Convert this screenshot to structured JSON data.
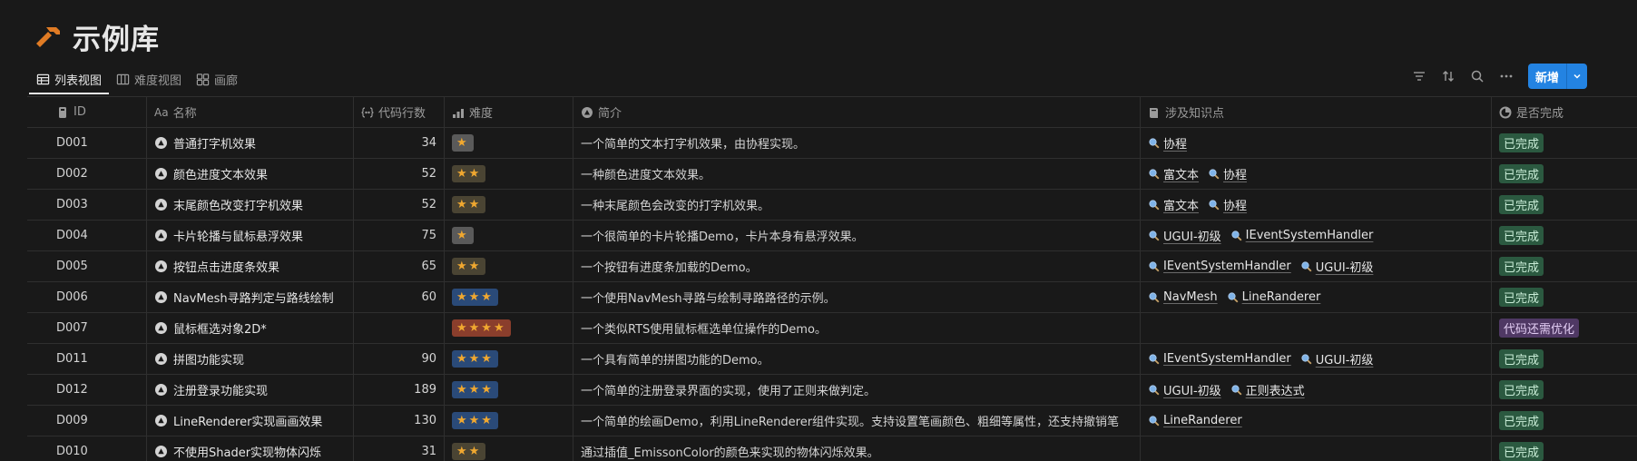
{
  "page": {
    "title": "示例库",
    "icon": "hammer-icon",
    "accent": "#e07b24"
  },
  "tabs": [
    {
      "label": "列表视图",
      "icon": "table-icon",
      "active": true
    },
    {
      "label": "难度视图",
      "icon": "board-icon",
      "active": false
    },
    {
      "label": "画廊",
      "icon": "gallery-icon",
      "active": false
    }
  ],
  "toolbar": {
    "icons": [
      "filter-icon",
      "sort-icon",
      "search-icon",
      "more-icon"
    ],
    "new_label": "新增",
    "new_color": "#2383e2"
  },
  "columns": {
    "id": "ID",
    "name": "名称",
    "lines": "代码行数",
    "difficulty": "难度",
    "desc": "简介",
    "knowledge": "涉及知识点",
    "done": "是否完成"
  },
  "rows": [
    {
      "id": "D001",
      "name": "普通打字机效果",
      "lines": "34",
      "stars": "★",
      "level": 1,
      "desc": "一个简单的文本打字机效果，由协程实现。",
      "tags": [
        "协程"
      ],
      "status": "已完成",
      "status_type": "ok"
    },
    {
      "id": "D002",
      "name": "颜色进度文本效果",
      "lines": "52",
      "stars": "★★",
      "level": 2,
      "desc": "一种颜色进度文本效果。",
      "tags": [
        "富文本",
        "协程"
      ],
      "status": "已完成",
      "status_type": "ok"
    },
    {
      "id": "D003",
      "name": "末尾颜色改变打字机效果",
      "lines": "52",
      "stars": "★★",
      "level": 2,
      "desc": "一种末尾颜色会改变的打字机效果。",
      "tags": [
        "富文本",
        "协程"
      ],
      "status": "已完成",
      "status_type": "ok"
    },
    {
      "id": "D004",
      "name": "卡片轮播与鼠标悬浮效果",
      "lines": "75",
      "stars": "★",
      "level": 1,
      "desc": "一个很简单的卡片轮播Demo，卡片本身有悬浮效果。",
      "tags": [
        "UGUI-初级",
        "IEventSystemHandler"
      ],
      "status": "已完成",
      "status_type": "ok"
    },
    {
      "id": "D005",
      "name": "按钮点击进度条效果",
      "lines": "65",
      "stars": "★★",
      "level": 2,
      "desc": "一个按钮有进度条加载的Demo。",
      "tags": [
        "IEventSystemHandler",
        "UGUI-初级"
      ],
      "status": "已完成",
      "status_type": "ok"
    },
    {
      "id": "D006",
      "name": "NavMesh寻路判定与路线绘制",
      "lines": "60",
      "stars": "★★★",
      "level": 3,
      "desc": "一个使用NavMesh寻路与绘制寻路路径的示例。",
      "tags": [
        "NavMesh",
        "LineRanderer"
      ],
      "status": "已完成",
      "status_type": "ok"
    },
    {
      "id": "D007",
      "name": "鼠标框选对象2D*",
      "lines": "",
      "stars": "★★★★",
      "level": 4,
      "desc": "一个类似RTS使用鼠标框选单位操作的Demo。",
      "tags": [],
      "status": "代码还需优化",
      "status_type": "opt"
    },
    {
      "id": "D011",
      "name": "拼图功能实现",
      "lines": "90",
      "stars": "★★★",
      "level": 3,
      "desc": "一个具有简单的拼图功能的Demo。",
      "tags": [
        "IEventSystemHandler",
        "UGUI-初级"
      ],
      "status": "已完成",
      "status_type": "ok"
    },
    {
      "id": "D012",
      "name": "注册登录功能实现",
      "lines": "189",
      "stars": "★★★",
      "level": 3,
      "desc": "一个简单的注册登录界面的实现，使用了正则来做判定。",
      "tags": [
        "UGUI-初级",
        "正则表达式"
      ],
      "status": "已完成",
      "status_type": "ok"
    },
    {
      "id": "D009",
      "name": "LineRenderer实现画画效果",
      "lines": "130",
      "stars": "★★★",
      "level": 3,
      "desc": "一个简单的绘画Demo，利用LineRenderer组件实现。支持设置笔画颜色、粗细等属性，还支持撤销笔",
      "tags": [
        "LineRanderer"
      ],
      "status": "已完成",
      "status_type": "ok"
    },
    {
      "id": "D010",
      "name": "不使用Shader实现物体闪烁",
      "lines": "31",
      "stars": "★★",
      "level": 2,
      "desc": "通过插值_EmissonColor的颜色来实现的物体闪烁效果。",
      "tags": [],
      "status": "已完成",
      "status_type": "ok"
    }
  ]
}
